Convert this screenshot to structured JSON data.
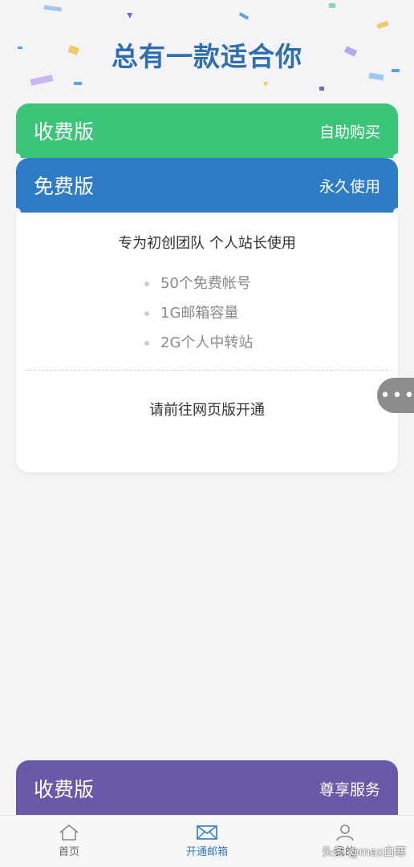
{
  "headline": "总有一款适合你",
  "plans": {
    "paid_self": {
      "name": "收费版",
      "tag": "自助购买"
    },
    "free": {
      "name": "免费版",
      "tag": "永久使用",
      "description": "专为初创团队 个人站长使用",
      "features": [
        "50个免费帐号",
        "1G邮箱容量",
        "2G个人中转站"
      ],
      "open_hint": "请前往网页版开通"
    },
    "paid_premium": {
      "name": "收费版",
      "tag": "尊享服务"
    }
  },
  "tabs": [
    {
      "label": "首页",
      "icon": "home-icon"
    },
    {
      "label": "开通邮箱",
      "icon": "mail-icon"
    },
    {
      "label": "我的",
      "icon": "user-icon"
    }
  ],
  "watermark": "头条 @max白寒",
  "colors": {
    "paid_green": "#3cc479",
    "free_blue": "#2f7cc6",
    "premium_purple": "#6a59a8",
    "headline_blue": "#2f6fb0"
  }
}
